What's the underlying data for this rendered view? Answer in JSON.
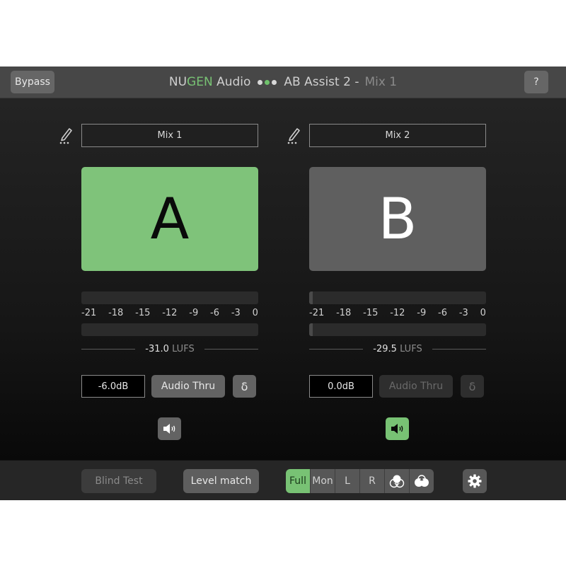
{
  "header": {
    "bypass_label": "Bypass",
    "brand_prefix": "NU",
    "brand_accent": "GEN",
    "brand_suffix": "Audio",
    "product": "AB Assist 2 -",
    "current_mix": "Mix 1",
    "help_label": "?"
  },
  "colors": {
    "accent_green": "#7fc37a",
    "inactive_grey": "#5f5f5f"
  },
  "mixes": [
    {
      "id": "A",
      "name": "Mix 1",
      "letter": "A",
      "selected": true,
      "meter_scale": [
        "-21",
        "-18",
        "-15",
        "-12",
        "-9",
        "-6",
        "-3",
        "0"
      ],
      "meter_fill": 0.0,
      "loudness_value": "-31.0",
      "loudness_unit": "LUFS",
      "gain": "-6.0dB",
      "audio_thru_label": "Audio Thru",
      "audio_thru_enabled": true,
      "delta_label": "δ",
      "speaker_active": false
    },
    {
      "id": "B",
      "name": "Mix 2",
      "letter": "B",
      "selected": false,
      "meter_scale": [
        "-21",
        "-18",
        "-15",
        "-12",
        "-9",
        "-6",
        "-3",
        "0"
      ],
      "meter_fill": 0.02,
      "loudness_value": "-29.5",
      "loudness_unit": "LUFS",
      "gain": "0.0dB",
      "audio_thru_label": "Audio Thru",
      "audio_thru_enabled": false,
      "delta_label": "δ",
      "speaker_active": true
    }
  ],
  "footer": {
    "blind_test_label": "Blind Test",
    "level_match_label": "Level match",
    "monitor_modes": [
      {
        "label": "Full",
        "active": true
      },
      {
        "label": "Mon",
        "active": false
      },
      {
        "label": "L",
        "active": false
      },
      {
        "label": "R",
        "active": false
      },
      {
        "label": "",
        "icon": "mid-circles-icon",
        "active": false
      },
      {
        "label": "",
        "icon": "side-circles-icon",
        "active": false
      }
    ],
    "settings_icon": "gear-icon"
  }
}
